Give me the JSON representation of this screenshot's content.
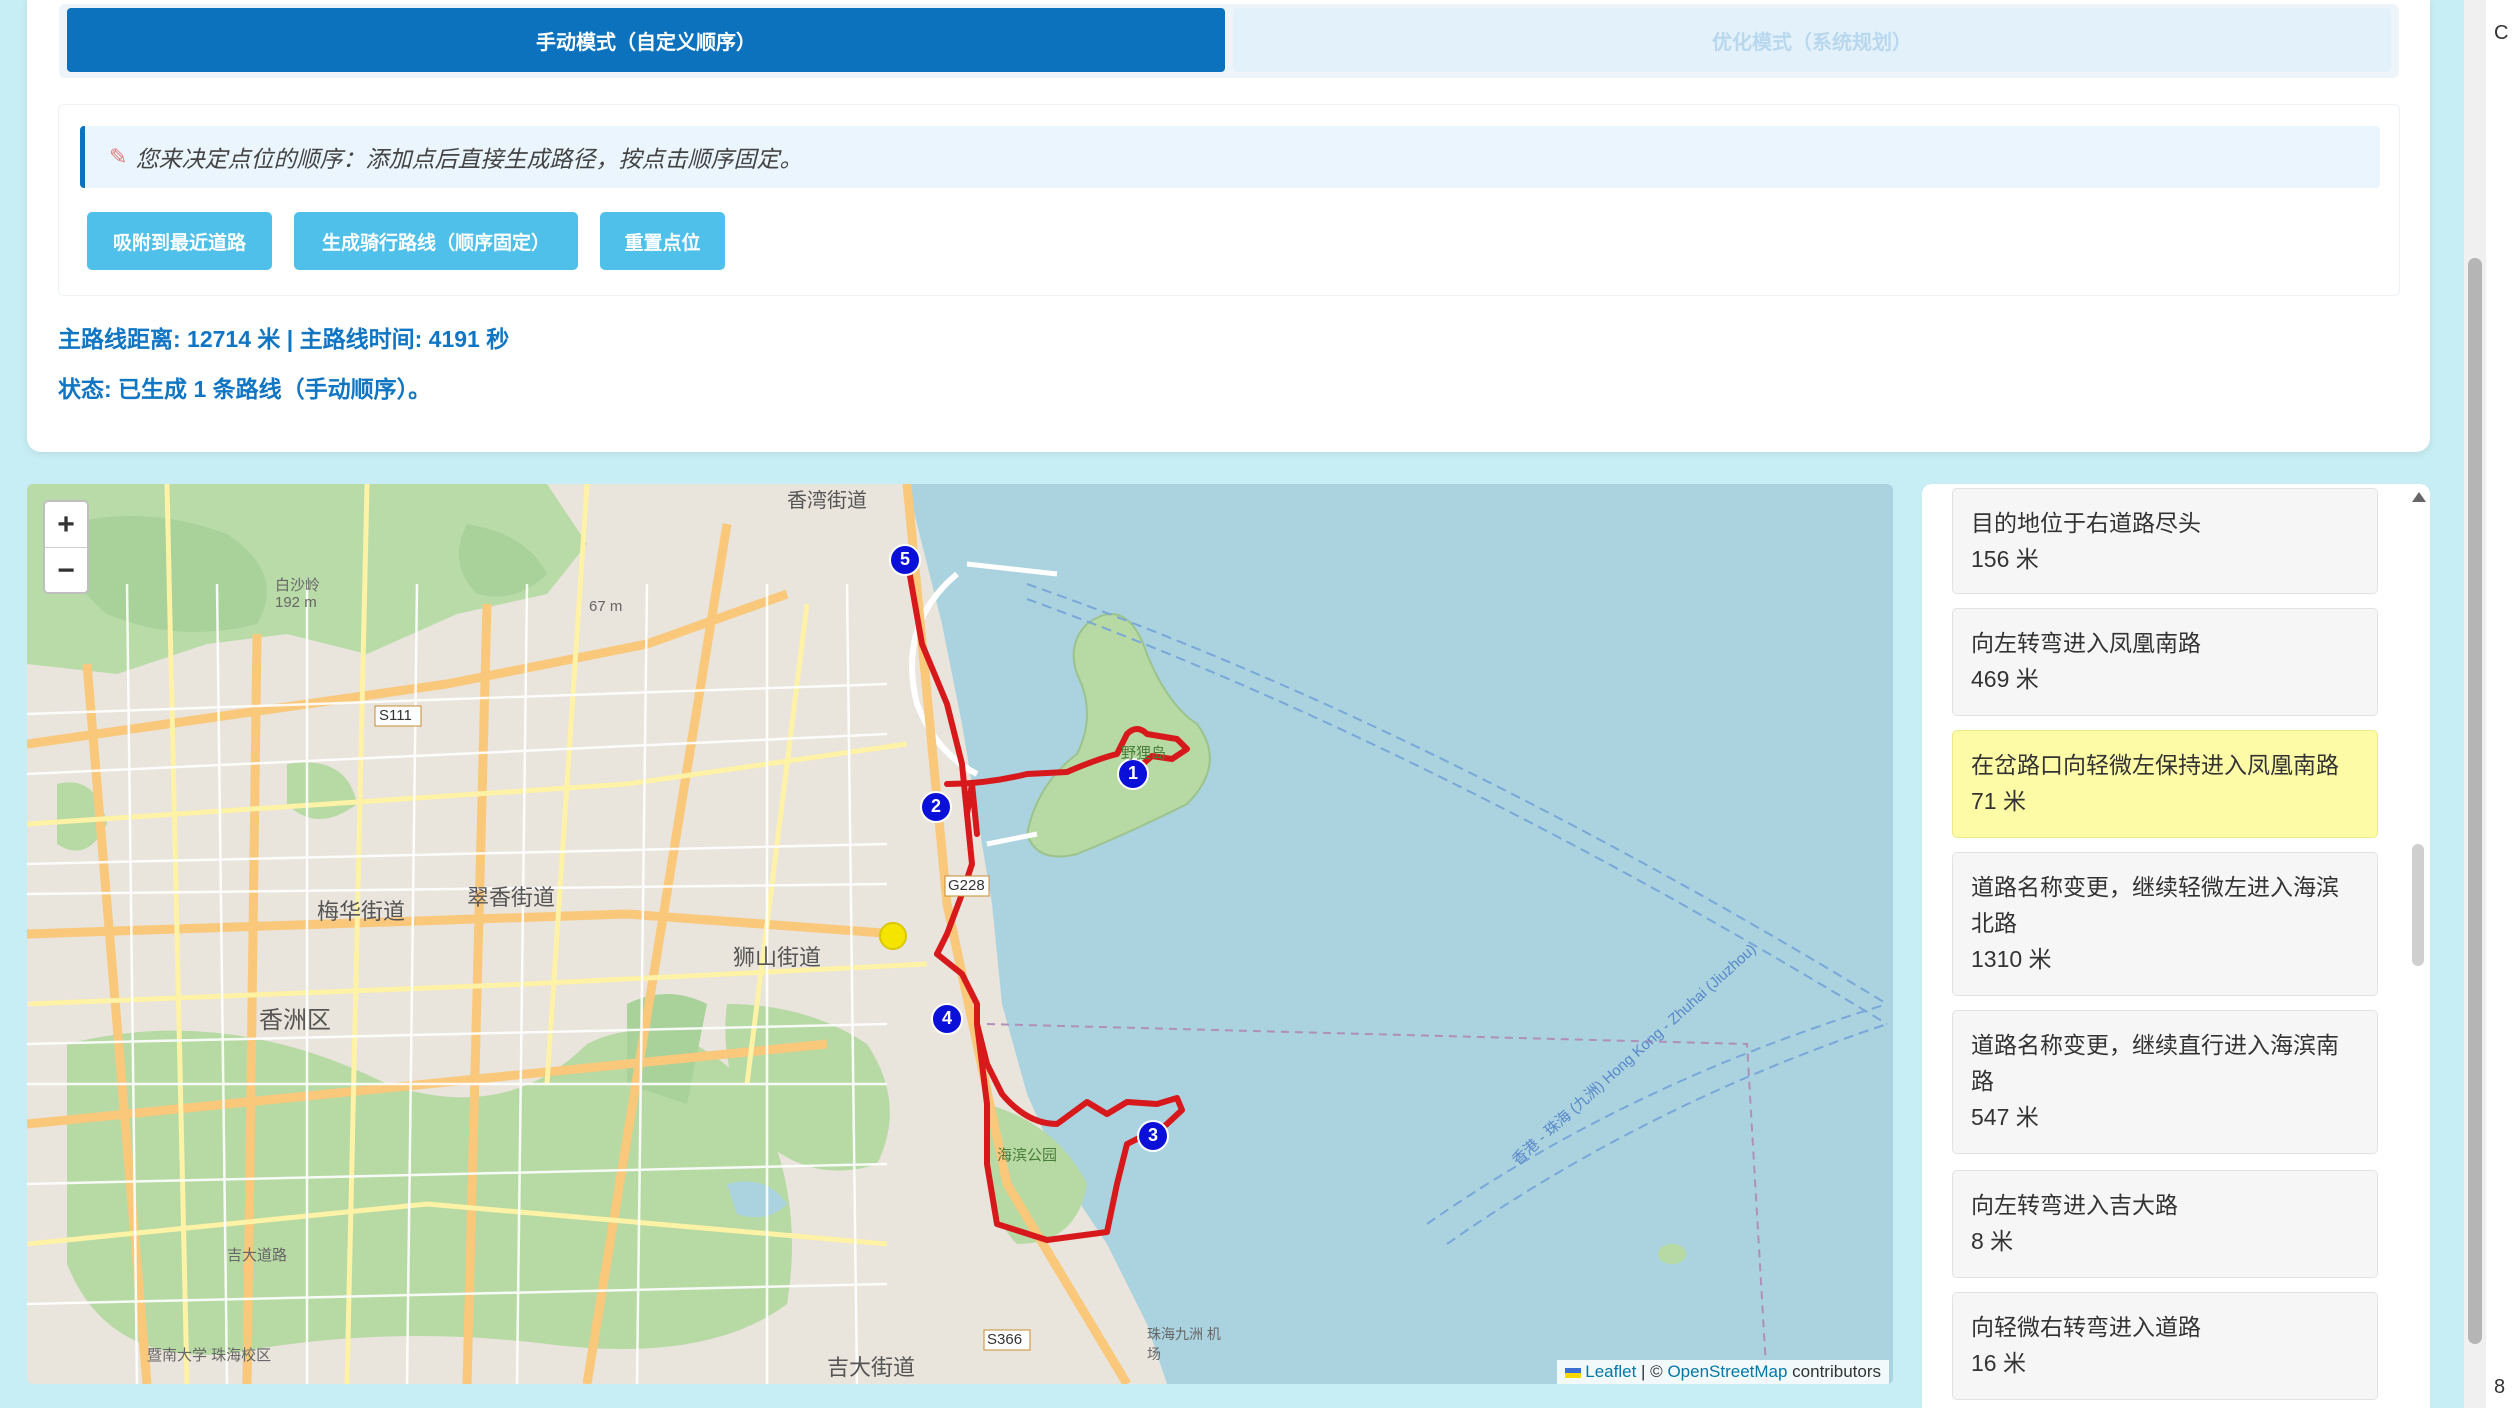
{
  "tabs": {
    "manual": "手动模式（自定义顺序）",
    "optimized": "优化模式（系统规划）"
  },
  "notice": {
    "icon": "pencil-icon",
    "text": "您来决定点位的顺序：添加点后直接生成路径，按点击顺序固定。"
  },
  "buttons": {
    "snap": "吸附到最近道路",
    "generate": "生成骑行路线（顺序固定）",
    "reset": "重置点位"
  },
  "stats": {
    "summary": "主路线距离: 12714 米 | 主路线时间: 4191 秒",
    "status": "状态: 已生成 1 条路线（手动顺序）。"
  },
  "map": {
    "zoom_in": "+",
    "zoom_out": "−",
    "attribution_leaflet": "Leaflet",
    "attribution_sep": " | © ",
    "attribution_osm": "OpenStreetMap",
    "attribution_tail": " contributors",
    "route_color": "#d7191c",
    "marker_color": "#0a10d8",
    "current_color": "#f5e400",
    "labels": {
      "hk_street": "香湾街道",
      "xiangzhou": "香洲区",
      "meihua": "梅华街道",
      "cuixiang": "翠香街道",
      "shishan": "狮山街道",
      "jida": "吉大街道",
      "g228": "G228",
      "s111": "S111",
      "s366": "S366",
      "haibin_park": "海滨公园",
      "yelang": "野狸岛",
      "baili": "白沙岭",
      "peak192": "192 m",
      "peak67": "67 m",
      "jida_road": "吉大道路",
      "jinan": "暨南大学 珠海校区",
      "airport": "珠海九洲 机场",
      "hk_route": "香港 - 珠海 (九洲) Hong Kong - Zhuhai (Jiuzhou)"
    },
    "markers": [
      "1",
      "2",
      "3",
      "4",
      "5"
    ]
  },
  "steps": [
    {
      "instruction": "目的地位于右道路尽头",
      "distance": "156 米",
      "highlight": false
    },
    {
      "instruction": "向左转弯进入凤凰南路",
      "distance": "469 米",
      "highlight": false
    },
    {
      "instruction": "在岔路口向轻微左保持进入凤凰南路",
      "distance": "71 米",
      "highlight": true
    },
    {
      "instruction": "道路名称变更，继续轻微左进入海滨北路",
      "distance": "1310 米",
      "highlight": false
    },
    {
      "instruction": "道路名称变更，继续直行进入海滨南路",
      "distance": "547 米",
      "highlight": false
    },
    {
      "instruction": "向左转弯进入吉大路",
      "distance": "8 米",
      "highlight": false
    },
    {
      "instruction": "向轻微右转弯进入道路",
      "distance": "16 米",
      "highlight": false
    }
  ],
  "edge_chars": [
    "C",
    "8"
  ]
}
